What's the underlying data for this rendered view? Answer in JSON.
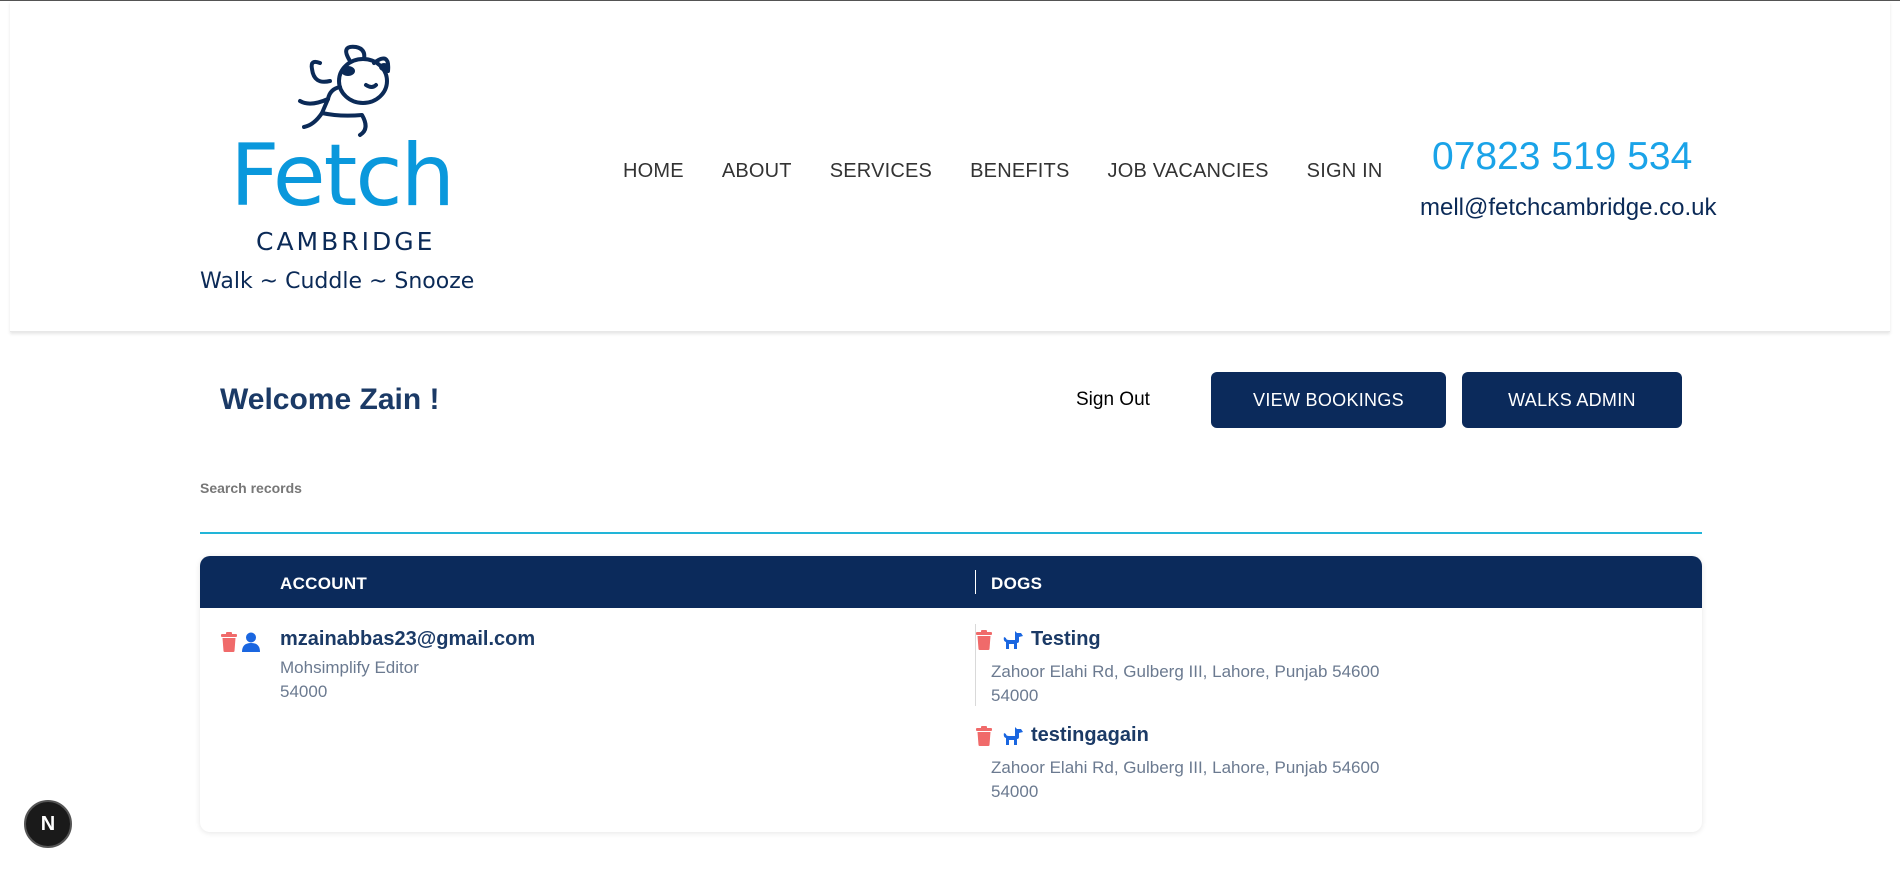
{
  "header": {
    "logo": {
      "word": "Fetch",
      "sub": "CAMBRIDGE",
      "tagline": "Walk  ~  Cuddle  ~  Snooze"
    },
    "nav": [
      "HOME",
      "ABOUT",
      "SERVICES",
      "BENEFITS",
      "JOB VACANCIES",
      "SIGN IN"
    ],
    "phone": "07823 519 534",
    "email": "mell@fetchcambridge.co.uk"
  },
  "main": {
    "welcome": "Welcome Zain !",
    "sign_out": "Sign Out",
    "view_bookings": "VIEW BOOKINGS",
    "walks_admin": "WALKS ADMIN",
    "search_label": "Search records",
    "table": {
      "columns": [
        "ACCOUNT",
        "DOGS"
      ],
      "rows": [
        {
          "account": {
            "email": "mzainabbas23@gmail.com",
            "line1": "Mohsimplify Editor",
            "line2": "54000"
          },
          "dogs": [
            {
              "name": "Testing",
              "address": "Zahoor Elahi Rd, Gulberg III, Lahore, Punjab 54600",
              "postcode": "54000"
            },
            {
              "name": "testingagain",
              "address": "Zahoor Elahi Rd, Gulberg III, Lahore, Punjab 54600",
              "postcode": "54000"
            }
          ]
        }
      ]
    }
  },
  "dev_badge": "N",
  "colors": {
    "navy": "#0b2a5b",
    "brand_blue": "#0a98dc",
    "delete_red": "#f06a6a",
    "icon_blue": "#1a66e0",
    "search_underline": "#22b5d8"
  }
}
